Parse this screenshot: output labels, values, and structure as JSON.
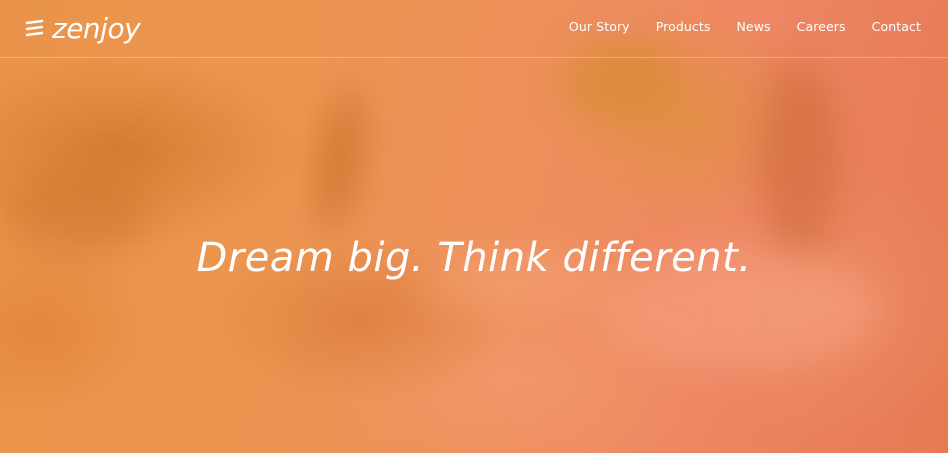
{
  "brand": {
    "name": "zenjoy",
    "icon": "zenjoy-logo-mark"
  },
  "nav": {
    "items": [
      {
        "label": "Our Story"
      },
      {
        "label": "Products"
      },
      {
        "label": "News"
      },
      {
        "label": "Careers"
      },
      {
        "label": "Contact"
      }
    ]
  },
  "hero": {
    "headline": "Dream big. Think different."
  },
  "colors": {
    "accent": "#ee8f5c",
    "text": "#ffffff"
  }
}
